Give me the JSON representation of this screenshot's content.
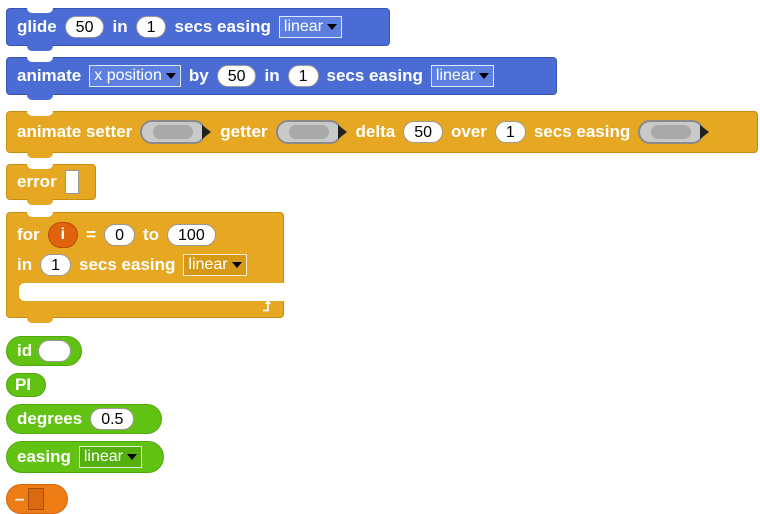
{
  "blocks": {
    "glide": {
      "label": "glide",
      "value": "50",
      "in": "in",
      "secs": "1",
      "secs_easing": "secs easing",
      "easing": "linear"
    },
    "animate": {
      "label": "animate",
      "property": "x position",
      "by": "by",
      "value": "50",
      "in": "in",
      "secs": "1",
      "secs_easing": "secs easing",
      "easing": "linear"
    },
    "animate_setter": {
      "label": "animate setter",
      "getter": "getter",
      "delta": "delta",
      "delta_value": "50",
      "over": "over",
      "secs": "1",
      "secs_easing": "secs easing"
    },
    "error": {
      "label": "error"
    },
    "for_loop": {
      "for": "for",
      "var": "i",
      "eq": "=",
      "from": "0",
      "to": "to",
      "to_value": "100",
      "in": "in",
      "secs": "1",
      "secs_easing": "secs easing",
      "easing": "linear"
    },
    "id": {
      "label": "id"
    },
    "pi": {
      "label": "PI"
    },
    "degrees": {
      "label": "degrees",
      "value": "0.5"
    },
    "easing": {
      "label": "easing",
      "value": "linear"
    },
    "neg": {
      "label": "–"
    }
  },
  "colors": {
    "motion": "#4a6cd4",
    "control": "#e6a822",
    "operators": "#62c213",
    "variables": "#ee7d16"
  }
}
